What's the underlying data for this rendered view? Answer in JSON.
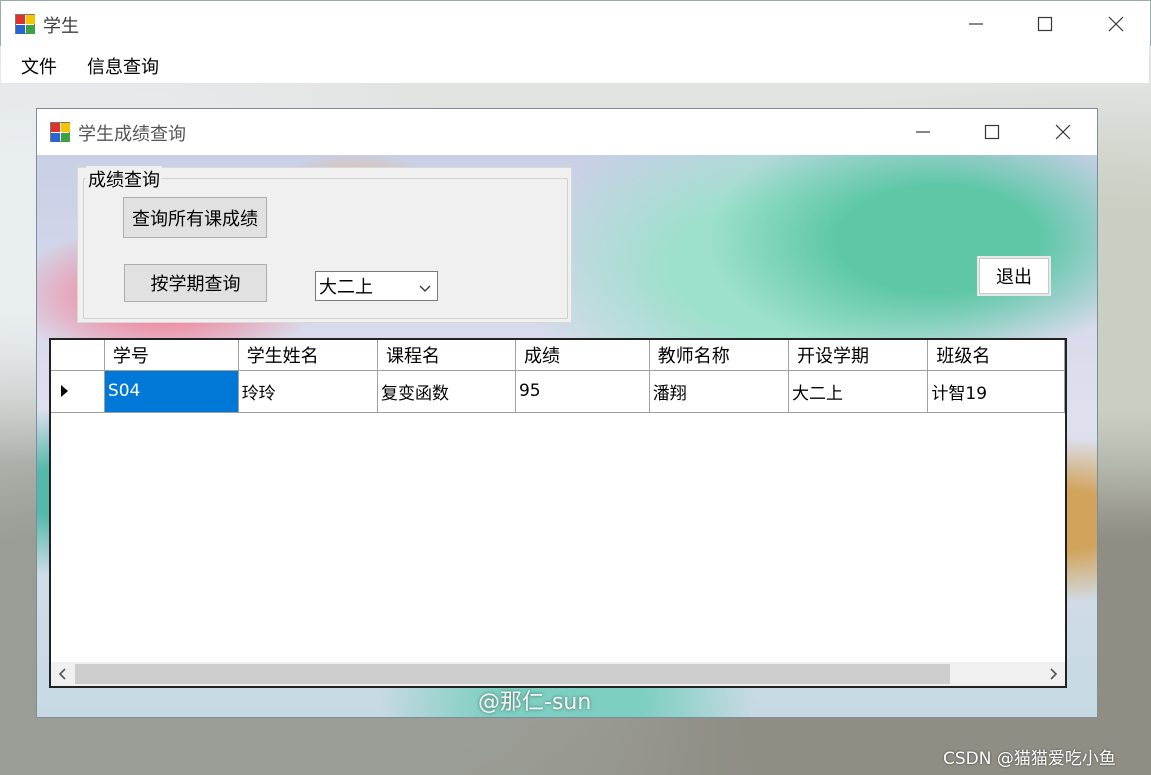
{
  "main_window": {
    "title": "学生",
    "menu": [
      "文件",
      "信息查询"
    ]
  },
  "child_window": {
    "title": "学生成绩查询",
    "groupbox_title": "成绩查询",
    "btn_all": "查询所有课成绩",
    "btn_term": "按学期查询",
    "term_selected": "大二上",
    "exit_label": "退出"
  },
  "grid": {
    "columns": [
      "学号",
      "学生姓名",
      "课程名",
      "成绩",
      "教师名称",
      "开设学期",
      "班级名"
    ],
    "rows": [
      [
        "S04",
        "玲玲",
        "复变函数",
        "95",
        "潘翔",
        "大二上",
        "计智19"
      ]
    ]
  },
  "watermarks": {
    "weibo": "@那仁-sun",
    "csdn": "CSDN @猫猫爱吃小鱼"
  }
}
